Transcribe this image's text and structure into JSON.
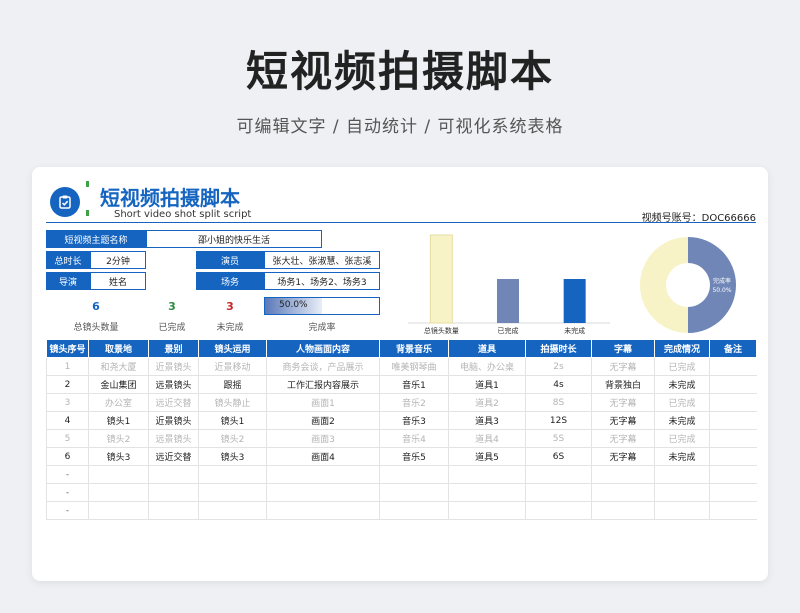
{
  "page": {
    "title": "短视频拍摄脚本",
    "subtitle": "可编辑文字 / 自动统计 / 可视化系统表格"
  },
  "sheet": {
    "title": "短视频拍摄脚本",
    "subtitle": "Short video shot split script",
    "account_label": "视频号账号：DOC66666",
    "logo_icon": "clipboard-check-icon",
    "accent_color": "#1565c0"
  },
  "info": {
    "theme_label": "短视频主题名称",
    "theme_value": "邵小姐的快乐生活",
    "duration_label": "总时长",
    "duration_value": "2分钟",
    "director_label": "导演",
    "director_value": "姓名",
    "actors_label": "演员",
    "actors_value": "张大壮、张淑慧、张志溪",
    "scenes_label": "场务",
    "scenes_value": "场务1、场务2、场务3"
  },
  "stats": {
    "total_value": "6",
    "total_label": "总镜头数量",
    "done_value": "3",
    "done_label": "已完成",
    "undone_value": "3",
    "undone_label": "未完成",
    "rate_value": "50.0%",
    "rate_fraction": 0.5,
    "rate_label": "完成率"
  },
  "chart_data": [
    {
      "type": "bar",
      "categories": [
        "总镜头数量",
        "已完成",
        "未完成"
      ],
      "values": [
        6,
        3,
        3
      ],
      "colors": [
        "#f7f3c6",
        "#6f86b6",
        "#1565c0"
      ],
      "ylim": [
        0,
        6
      ],
      "grid": false
    },
    {
      "type": "pie",
      "variant": "donut",
      "slices": [
        {
          "label": "完成率",
          "value": 50.0,
          "color": "#6f86b6"
        },
        {
          "label": "",
          "value": 50.0,
          "color": "#f7f3c6"
        }
      ],
      "annotation_label": "完成率",
      "annotation_value": "50.0%"
    }
  ],
  "table": {
    "headers": [
      "镜头序号",
      "取景地",
      "景别",
      "镜头运用",
      "人物画面内容",
      "背景音乐",
      "道具",
      "拍摄时长",
      "字幕",
      "完成情况",
      "备注"
    ],
    "rows": [
      {
        "style": "dim",
        "cells": [
          "1",
          "和尧大厦",
          "近景镜头",
          "近景移动",
          "商务会谈，产品展示",
          "唯美钢琴曲",
          "电脑、办公桌",
          "2s",
          "无字幕",
          "已完成",
          ""
        ]
      },
      {
        "style": "dark",
        "cells": [
          "2",
          "金山集团",
          "远景镜头",
          "跟摇",
          "工作汇报内容展示",
          "音乐1",
          "道具1",
          "4s",
          "背景独白",
          "未完成",
          ""
        ]
      },
      {
        "style": "dim",
        "cells": [
          "3",
          "办公室",
          "远近交替",
          "镜头静止",
          "画面1",
          "音乐2",
          "道具2",
          "8S",
          "无字幕",
          "已完成",
          ""
        ]
      },
      {
        "style": "dark",
        "cells": [
          "4",
          "镜头1",
          "近景镜头",
          "镜头1",
          "画面2",
          "音乐3",
          "道具3",
          "12S",
          "无字幕",
          "未完成",
          ""
        ]
      },
      {
        "style": "dim",
        "cells": [
          "5",
          "镜头2",
          "远景镜头",
          "镜头2",
          "画面3",
          "音乐4",
          "道具4",
          "5S",
          "无字幕",
          "已完成",
          ""
        ]
      },
      {
        "style": "dark",
        "cells": [
          "6",
          "镜头3",
          "远近交替",
          "镜头3",
          "画面4",
          "音乐5",
          "道具5",
          "6S",
          "无字幕",
          "未完成",
          ""
        ]
      },
      {
        "style": "empty",
        "cells": [
          "-",
          "",
          "",
          "",
          "",
          "",
          "",
          "",
          "",
          "",
          ""
        ]
      },
      {
        "style": "empty",
        "cells": [
          "-",
          "",
          "",
          "",
          "",
          "",
          "",
          "",
          "",
          "",
          ""
        ]
      },
      {
        "style": "empty",
        "cells": [
          "-",
          "",
          "",
          "",
          "",
          "",
          "",
          "",
          "",
          "",
          ""
        ]
      }
    ]
  }
}
